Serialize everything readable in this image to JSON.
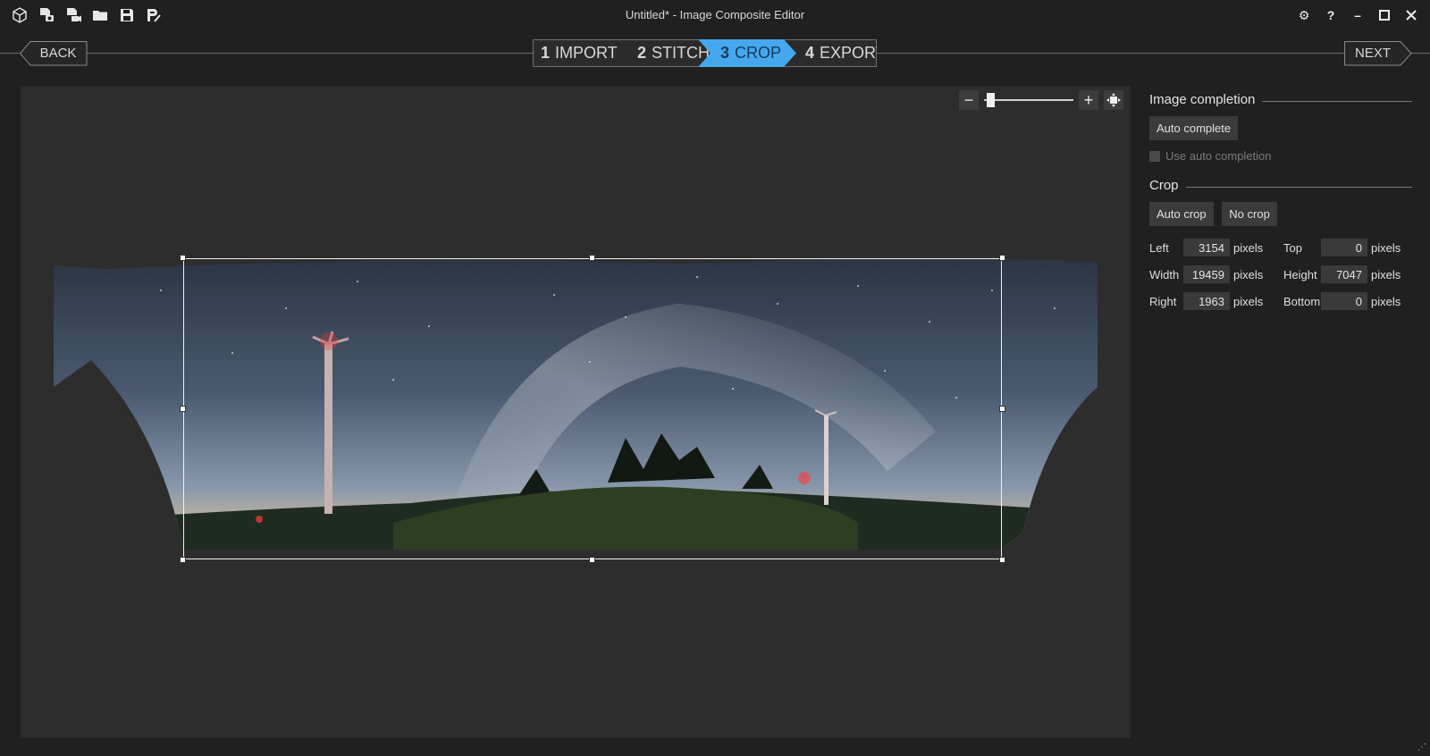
{
  "app": {
    "title": "Untitled* - Image Composite Editor"
  },
  "toolbar": {
    "icons": [
      "new-project-icon",
      "new-panorama-from-images-icon",
      "new-panorama-from-video-icon",
      "open-icon",
      "save-icon",
      "export-icon"
    ]
  },
  "window": {
    "settings_icon": "⚙",
    "help": "?",
    "minimize": "–",
    "maximize": "□",
    "close": "✕"
  },
  "nav": {
    "back": "BACK",
    "next": "NEXT"
  },
  "steps": [
    {
      "num": "1",
      "label": "IMPORT",
      "active": false
    },
    {
      "num": "2",
      "label": "STITCH",
      "active": false
    },
    {
      "num": "3",
      "label": "CROP",
      "active": true
    },
    {
      "num": "4",
      "label": "EXPORT",
      "active": false
    }
  ],
  "zoom": {
    "minus": "−",
    "plus": "+",
    "level": 0.03
  },
  "panel": {
    "completion": {
      "heading": "Image completion",
      "auto_complete": "Auto complete",
      "use_auto": "Use auto completion"
    },
    "crop": {
      "heading": "Crop",
      "auto_crop": "Auto crop",
      "no_crop": "No crop",
      "left_label": "Left",
      "left_value": "3154",
      "top_label": "Top",
      "top_value": "0",
      "width_label": "Width",
      "width_value": "19459",
      "height_label": "Height",
      "height_value": "7047",
      "right_label": "Right",
      "right_value": "1963",
      "bottom_label": "Bottom",
      "bottom_value": "0",
      "unit": "pixels"
    }
  },
  "colors": {
    "accent": "#45a8ee",
    "background": "#202020",
    "canvas": "#2d2d2d"
  }
}
